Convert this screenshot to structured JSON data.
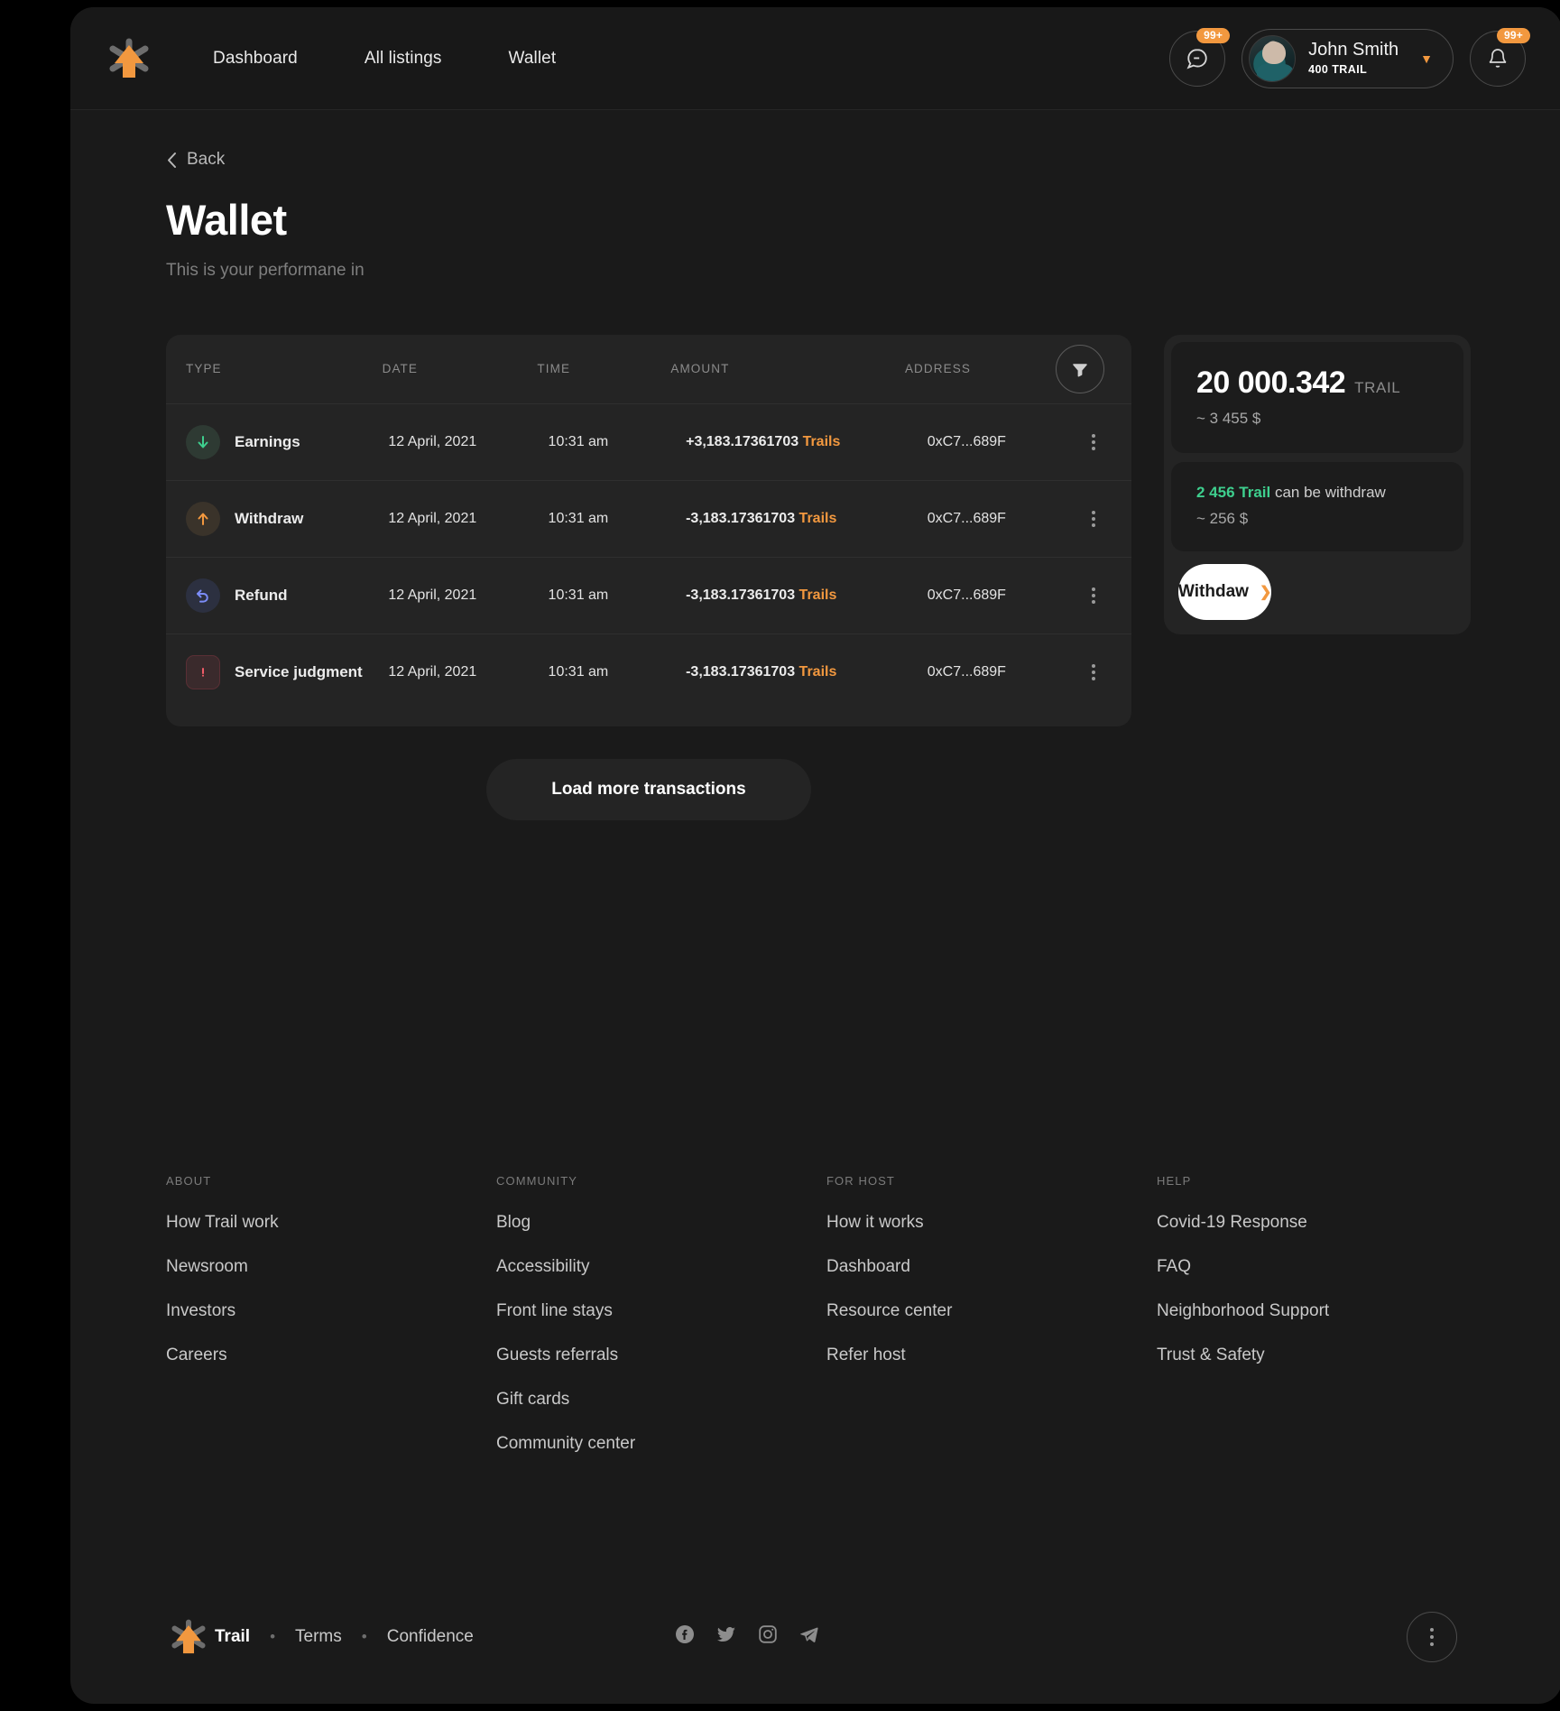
{
  "header": {
    "logo_icon": "trail-asterisk-logo",
    "nav": [
      {
        "label": "Dashboard"
      },
      {
        "label": "All listings"
      },
      {
        "label": "Wallet"
      }
    ],
    "messages": {
      "icon": "chat-bubble-icon",
      "badge": "99+"
    },
    "notifications": {
      "icon": "bell-icon",
      "badge": "99+"
    },
    "user": {
      "name": "John Smith",
      "balance": "400 TRAIL",
      "avatar_icon": "user-avatar",
      "chevron_icon": "chevron-down-icon"
    }
  },
  "page": {
    "back_label": "Back",
    "back_icon": "chevron-left-icon",
    "title": "Wallet",
    "subtitle": "This is your performane in"
  },
  "transactions": {
    "filter_icon": "filter-funnel-icon",
    "columns": [
      "TYPE",
      "DATE",
      "TIME",
      "AMOUNT",
      "ADDRESS"
    ],
    "rows": [
      {
        "icon": "arrow-down-icon",
        "icon_kind": "earnings",
        "type": "Earnings",
        "date": "12 April, 2021",
        "time": "10:31 am",
        "amount": "+3,183.17361703",
        "amount_unit": "Trails",
        "address": "0xC7...689F",
        "menu_icon": "kebab-menu-icon"
      },
      {
        "icon": "arrow-up-icon",
        "icon_kind": "withdraw",
        "type": "Withdraw",
        "date": "12 April, 2021",
        "time": "10:31 am",
        "amount": "-3,183.17361703",
        "amount_unit": "Trails",
        "address": "0xC7...689F",
        "menu_icon": "kebab-menu-icon"
      },
      {
        "icon": "arrow-undo-icon",
        "icon_kind": "refund",
        "type": "Refund",
        "date": "12 April, 2021",
        "time": "10:31 am",
        "amount": "-3,183.17361703",
        "amount_unit": "Trails",
        "address": "0xC7...689F",
        "menu_icon": "kebab-menu-icon"
      },
      {
        "icon": "alert-exclamation-icon",
        "icon_kind": "service",
        "type": "Service judgment",
        "date": "12 April, 2021",
        "time": "10:31 am",
        "amount": "-3,183.17361703",
        "amount_unit": "Trails",
        "address": "0xC7...689F",
        "menu_icon": "kebab-menu-icon"
      }
    ],
    "load_more_label": "Load more transactions"
  },
  "balance": {
    "amount": "20 000.342",
    "unit": "TRAIL",
    "usd": "~ 3 455 $",
    "withdrawable_amount": "2 456 Trail",
    "withdrawable_text": " can be withdraw",
    "withdrawable_usd": "~ 256 $",
    "withdraw_button": "Withdaw",
    "withdraw_arrow_icon": "chevron-right-icon"
  },
  "footer": {
    "columns": [
      {
        "title": "ABOUT",
        "links": [
          "How Trail work",
          "Newsroom",
          "Investors",
          "Careers"
        ]
      },
      {
        "title": "COMMUNITY",
        "links": [
          "Blog",
          "Accessibility",
          "Front line stays",
          "Guests referrals",
          "Gift cards",
          "Community center"
        ]
      },
      {
        "title": "FOR HOST",
        "links": [
          "How it works",
          "Dashboard",
          "Resource center",
          "Refer host"
        ]
      },
      {
        "title": "HELP",
        "links": [
          "Covid-19 Response",
          "FAQ",
          "Neighborhood Support",
          "Trust & Safety"
        ]
      }
    ],
    "bar": {
      "brand": "Trail",
      "separator": "•",
      "terms": "Terms",
      "confidence": "Confidence",
      "socials": [
        "facebook-icon",
        "twitter-icon",
        "instagram-icon",
        "telegram-icon"
      ],
      "more_icon": "kebab-menu-icon"
    }
  },
  "colors": {
    "accent": "#f2983f",
    "positive": "#3ecf8e",
    "negative": "#f15c68",
    "refund": "#7b8cf7",
    "background": "#1a1a1a",
    "card": "#242424"
  }
}
